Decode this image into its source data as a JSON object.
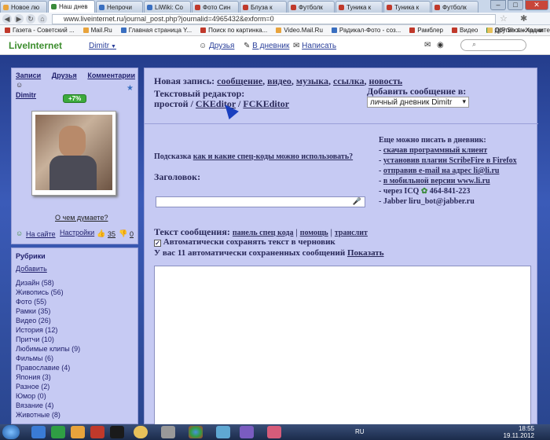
{
  "browser": {
    "tabs": [
      {
        "label": "Новое лю",
        "color": "#e8a33c"
      },
      {
        "label": "Наш днев",
        "color": "#3a8a3a",
        "active": true
      },
      {
        "label": "Непрочи",
        "color": "#3a6fc0"
      },
      {
        "label": "LiWiki: Co",
        "color": "#3a6fc0"
      },
      {
        "label": "Фото Син",
        "color": "#c0392b"
      },
      {
        "label": "Блуза к",
        "color": "#c0392b"
      },
      {
        "label": "Футболк",
        "color": "#c0392b"
      },
      {
        "label": "Туника к",
        "color": "#c0392b"
      },
      {
        "label": "Туника к",
        "color": "#c0392b"
      },
      {
        "label": "Футболк",
        "color": "#c0392b"
      }
    ],
    "url": "www.liveinternet.ru/journal_post.php?journalid=4965432&exform=0",
    "bookmarks": [
      {
        "label": "Газета - Советский ...",
        "color": "#c0392b"
      },
      {
        "label": "Mail.Ru",
        "color": "#e8a33c"
      },
      {
        "label": "Главная страница Y...",
        "color": "#3a6fc0"
      },
      {
        "label": "Поиск по картинка...",
        "color": "#c0392b"
      },
      {
        "label": "Video.Mail.Ru",
        "color": "#e8a33c"
      },
      {
        "label": "Радикал-Фото - соз...",
        "color": "#3a6fc0"
      },
      {
        "label": "Рамблер",
        "color": "#c0392b"
      },
      {
        "label": "Видео",
        "color": "#c0392b"
      },
      {
        "label": "QIP Shot - Храните ...",
        "color": "#3a8a3a"
      }
    ],
    "other_bookmarks": "Другие закладки"
  },
  "header": {
    "logo": "LiveInternet",
    "user": "Dimitr",
    "links": {
      "friends": "Друзья",
      "diary": "В дневник",
      "write": "Написать"
    }
  },
  "sidebar": {
    "top_links": {
      "posts": "Записи",
      "friends": "Друзья",
      "comments": "Комментарии"
    },
    "username": "Dimitr",
    "rating": "+7%",
    "mood": "О чем думаете?",
    "online": "На сайте",
    "likes": "35",
    "dislikes": "0",
    "settings": "Настройки",
    "rubrics_title": "Рубрики",
    "add": "Добавить",
    "rubrics": [
      "Дизайн (58)",
      "Живопись (56)",
      "Фото (55)",
      "Рамки (35)",
      "Видео (26)",
      "История (12)",
      "Притчи (10)",
      "Любимые клипы (9)",
      "Фильмы (6)",
      "Православие (4)",
      "Япония (3)",
      "Разное (2)",
      "Юмор (0)",
      "Вязание (4)",
      "Животные (8)"
    ]
  },
  "main": {
    "new_post": "Новая запись:",
    "types": {
      "message": "сообщение",
      "video": "видео",
      "music": "музыка",
      "link": "ссылка",
      "news": "новость"
    },
    "editor_label": "Текстовый редактор:",
    "editor_simple": "простой",
    "editor_ck": "CKEditor",
    "editor_fck": "FCKEditor",
    "add_to": "Добавить сообщение в:",
    "target": "личный дневник Dimitr",
    "hint_prefix": "Подсказка",
    "hint_link": "как и какие спец-коды можно использовать?",
    "title_label": "Заголовок:",
    "also_write": "Еще можно писать в дневник:",
    "options": [
      "скачав программный клиент",
      "установив плагин ScribeFire в Firefox",
      "отправив e-mail на адрес li@li.ru",
      "в мобильной версии www.li.ru"
    ],
    "icq_prefix": "- через ICQ",
    "icq_number": "464-841-223",
    "jabber": "- Jabber liru_bot@jabber.ru",
    "text_label": "Текст сообщения:",
    "text_links": {
      "codes": "панель спец кода",
      "help": "помощь",
      "translit": "транслит"
    },
    "autosave": "Автоматически сохранять текст в черновик",
    "saved_prefix": "У вас 11 автоматически сохраненных сообщений",
    "show": "Показать"
  },
  "taskbar": {
    "lang": "RU",
    "time": "18:55",
    "date": "19.11.2012"
  }
}
